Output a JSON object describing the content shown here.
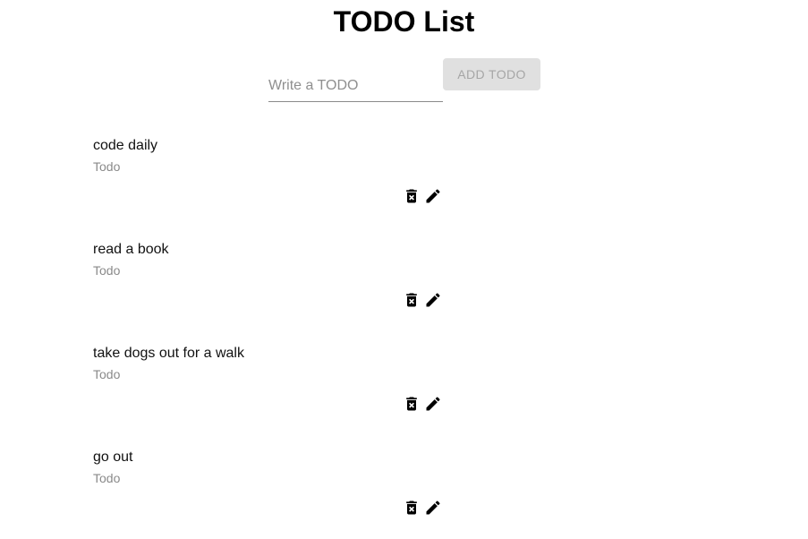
{
  "header": {
    "title": "TODO List"
  },
  "form": {
    "input_placeholder": "Write a TODO",
    "input_value": "",
    "add_button_label": "ADD TODO",
    "add_button_disabled": true
  },
  "todos": [
    {
      "text": "code daily",
      "status": "Todo",
      "icons": [
        "delete-forever-icon",
        "edit-pencil-icon"
      ]
    },
    {
      "text": "read a book",
      "status": "Todo",
      "icons": [
        "delete-forever-icon",
        "edit-pencil-icon"
      ]
    },
    {
      "text": "take dogs out for a walk",
      "status": "Todo",
      "icons": [
        "delete-forever-icon",
        "edit-pencil-icon"
      ]
    },
    {
      "text": "go out",
      "status": "Todo",
      "icons": [
        "delete-forever-icon",
        "edit-pencil-icon"
      ]
    }
  ],
  "colors": {
    "button_disabled_bg": "#e0e0e0",
    "button_disabled_text": "#a6a6a6",
    "secondary_text": "#8a8a8a",
    "input_underline": "#8a8a8a"
  }
}
